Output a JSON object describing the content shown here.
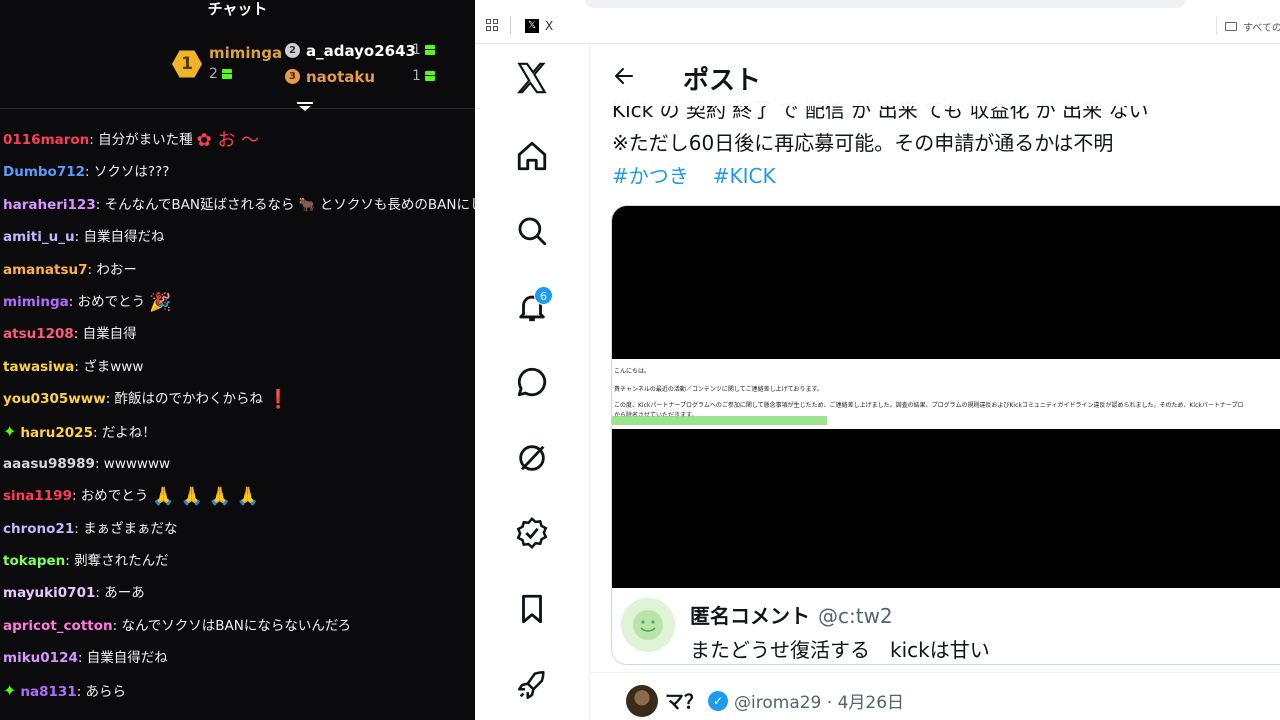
{
  "chat": {
    "title": "チャット",
    "leaderboard": {
      "first": {
        "rank": "1",
        "name": "miminga",
        "count": "2",
        "color": "#d9a33a"
      },
      "second": {
        "rank": "2",
        "name": "a_adayo2643",
        "count": "1",
        "color": "#ffffff"
      },
      "third": {
        "rank": "3",
        "name": "naotaku",
        "count": "1",
        "color": "#e59a4c"
      }
    },
    "messages": [
      {
        "user": "0116maron",
        "sep": ": ",
        "text": "自分がまいた種",
        "emote": "✿ お 〜",
        "color": "#ff3d54",
        "star": false
      },
      {
        "user": "Dumbo712",
        "sep": ": ",
        "text": "ソクソは???",
        "emote": "",
        "color": "#5a9bff",
        "star": false
      },
      {
        "user": "haraheri123",
        "sep": ": ",
        "text": "そんなんでBAN延ばされるなら 🐂 とソクソも長めのBANにし",
        "emote": "",
        "color": "#d895ff",
        "star": false
      },
      {
        "user": "amiti_u_u",
        "sep": ": ",
        "text": "自業自得だね",
        "emote": "",
        "color": "#c4b5ff",
        "star": false
      },
      {
        "user": "amanatsu7",
        "sep": ": ",
        "text": "わおー",
        "emote": "",
        "color": "#ffb23d",
        "star": false
      },
      {
        "user": "miminga",
        "sep": ": ",
        "text": "おめでとう",
        "emote": "🎉",
        "color": "#b36bff",
        "star": false
      },
      {
        "user": "atsu1208",
        "sep": ": ",
        "text": "自業自得",
        "emote": "",
        "color": "#ff5a78",
        "star": false
      },
      {
        "user": "tawasiwa",
        "sep": ": ",
        "text": "ざまwww",
        "emote": "",
        "color": "#ffd23d",
        "star": false
      },
      {
        "user": "you0305www",
        "sep": ": ",
        "text": "酢飯はのでかわくからね",
        "emote": "❗",
        "color": "#ffd23d",
        "star": false
      },
      {
        "user": "haru2025",
        "sep": ": ",
        "text": "だよね！",
        "emote": "",
        "color": "#ffd23d",
        "star": true
      },
      {
        "user": "aaasu98989",
        "sep": ": ",
        "text": "wwwwww",
        "emote": "",
        "color": "#d7d7d7",
        "star": false
      },
      {
        "user": "sina1199",
        "sep": ": ",
        "text": "おめでとう",
        "emote": "🙏 🙏 🙏 🙏",
        "color": "#ff3d54",
        "star": false
      },
      {
        "user": "chrono21",
        "sep": ": ",
        "text": "まぁざまぁだな",
        "emote": "",
        "color": "#c4b5ff",
        "star": false
      },
      {
        "user": "tokapen",
        "sep": ": ",
        "text": "剥奪されたんだ",
        "emote": "",
        "color": "#7dff5a",
        "star": false
      },
      {
        "user": "mayuki0701",
        "sep": ": ",
        "text": "あーあ",
        "emote": "",
        "color": "#e8c8ff",
        "star": false
      },
      {
        "user": "apricot_cotton",
        "sep": ": ",
        "text": "なんでソクソはBANにならないんだろ",
        "emote": "",
        "color": "#ff7ad9",
        "star": false
      },
      {
        "user": "miku0124",
        "sep": ": ",
        "text": "自業自得だね",
        "emote": "",
        "color": "#d895ff",
        "star": false
      },
      {
        "user": "na8131",
        "sep": ": ",
        "text": "あらら",
        "emote": "",
        "color": "#b36bff",
        "star": true
      }
    ]
  },
  "browser": {
    "tab_label": "X",
    "bookmarks_label": "すべてのブ",
    "notification_count": "6",
    "page_title": "ポスト",
    "post": {
      "cut_line": "Kick の 契約 終了 で 配信 が 出来 ても 収益化 が 出来 ない",
      "body": "※ただし60日後に再応募可能。その申請が通るかは不明",
      "hashtags": [
        "#かつき",
        "#KICK"
      ],
      "screenshot_lines": [
        "こんにちは。",
        "貴チャンネルの最近の活動／コンテンツに関してご連絡差し上げております。",
        "この度、Kickパートナープログラムへのご参加に関して懸念事項が生じたため、ご連絡差し上げました。調査の結果、プログラムの規則違反およびKickコミュニティガイドライン違反が認められました。そのため、Kickパートナープロ",
        "から除名させていただきます。"
      ],
      "quote": {
        "name": "匿名コメント",
        "handle": "@c:tw2",
        "text": "またどうせ復活する　kickは甘い"
      }
    },
    "reply": {
      "name": "マ？",
      "handle": "@iroma29 · 4月26日"
    }
  }
}
